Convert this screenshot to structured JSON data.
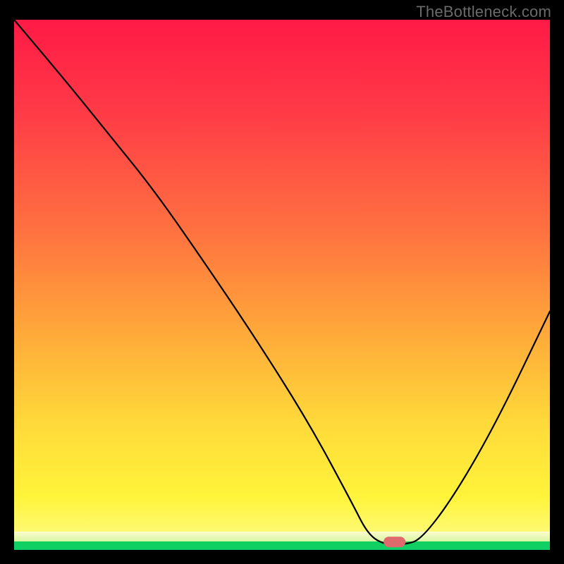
{
  "watermark": "TheBottleneck.com",
  "chart_data": {
    "type": "line",
    "title": "",
    "xlabel": "",
    "ylabel": "",
    "xlim": [
      0,
      100
    ],
    "ylim": [
      0,
      100
    ],
    "series": [
      {
        "name": "bottleneck-curve",
        "x": [
          0,
          10,
          18,
          26,
          35,
          45,
          55,
          63,
          66,
          69,
          73,
          76,
          82,
          90,
          100
        ],
        "y": [
          100,
          88,
          78,
          68,
          55,
          40,
          24,
          9,
          3,
          1,
          1,
          2,
          10,
          24,
          45
        ]
      }
    ],
    "marker": {
      "x": 71,
      "y": 1.5,
      "label": "selected-point"
    },
    "gradient_bands": [
      {
        "color": "#ff1a46",
        "from_pct": 0,
        "to_pct": 18
      },
      {
        "color": "#ff7240",
        "from_pct": 18,
        "to_pct": 58
      },
      {
        "color": "#ffd93a",
        "from_pct": 58,
        "to_pct": 90
      },
      {
        "color": "#fdfccf",
        "from_pct": 90,
        "to_pct": 98
      },
      {
        "color": "#11d061",
        "from_pct": 98,
        "to_pct": 100
      }
    ]
  }
}
